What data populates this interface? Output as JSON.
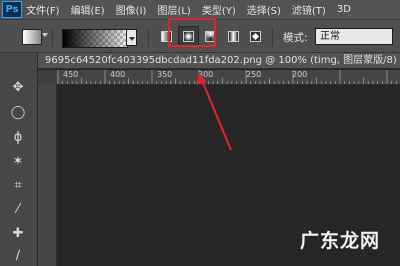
{
  "app": {
    "logo": "Ps"
  },
  "menu": {
    "items": [
      "文件(F)",
      "编辑(E)",
      "图像(I)",
      "图层(L)",
      "类型(Y)",
      "选择(S)",
      "滤镜(T)",
      "3D"
    ]
  },
  "options_bar": {
    "mode_label": "模式:",
    "mode_value": "正常",
    "gradient_buttons": [
      "linear-gradient-icon",
      "radial-gradient-icon",
      "angle-gradient-icon",
      "reflected-gradient-icon",
      "diamond-gradient-icon"
    ],
    "selected_gradient": "radial-gradient-icon"
  },
  "document": {
    "tab_title": "9695c64520fc403395dbcdad11fda202.png @ 100% (timg, 图层蒙版/8)",
    "ruler_labels": [
      "450",
      "400",
      "350",
      "300",
      "250",
      "200"
    ]
  },
  "annotation": {
    "color": "#e0242a"
  },
  "watermark": "广东龙网"
}
